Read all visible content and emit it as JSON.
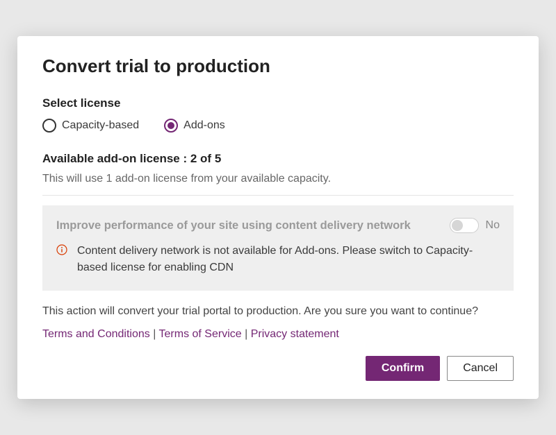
{
  "title": "Convert trial to production",
  "select_license": {
    "label": "Select license",
    "options": {
      "capacity": "Capacity-based",
      "addons": "Add-ons"
    },
    "selected": "addons"
  },
  "availability": "Available add-on license : 2 of 5",
  "description": "This will use 1 add-on license from your available capacity.",
  "cdn": {
    "title": "Improve performance of your site using content delivery network",
    "toggle_state": "No",
    "warning": "Content delivery network is not available for Add-ons. Please switch to Capacity-based license for enabling CDN"
  },
  "confirm_text": "This action will convert your trial portal to production. Are you sure you want to continue?",
  "links": {
    "terms_conditions": "Terms and Conditions",
    "terms_service": "Terms of Service",
    "privacy": "Privacy statement"
  },
  "buttons": {
    "confirm": "Confirm",
    "cancel": "Cancel"
  }
}
